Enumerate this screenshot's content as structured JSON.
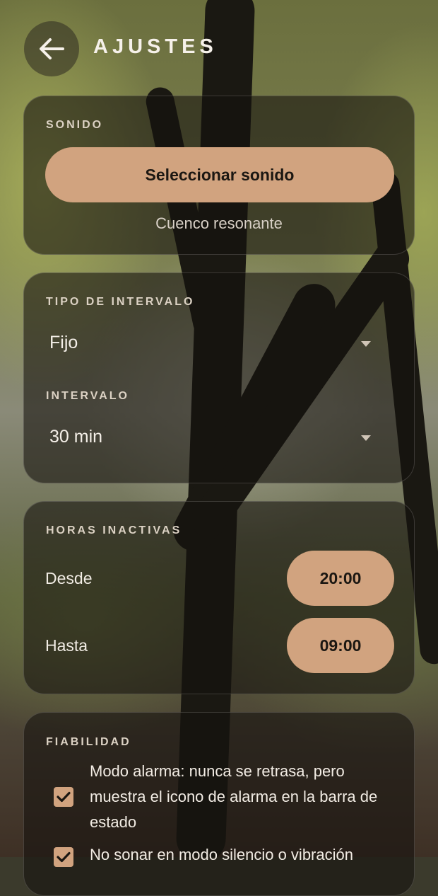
{
  "header": {
    "title": "AJUSTES",
    "back_icon": "arrow-left-icon"
  },
  "sound": {
    "section_label": "SONIDO",
    "select_button": "Seleccionar sonido",
    "current_sound": "Cuenco resonante"
  },
  "interval": {
    "type_label": "TIPO DE INTERVALO",
    "type_value": "Fijo",
    "interval_label": "INTERVALO",
    "interval_value": "30 min"
  },
  "inactive_hours": {
    "section_label": "HORAS INACTIVAS",
    "from_label": "Desde",
    "from_value": "20:00",
    "to_label": "Hasta",
    "to_value": "09:00"
  },
  "reliability": {
    "section_label": "FIABILIDAD",
    "options": [
      {
        "text": "Modo alarma: nunca se retrasa, pero muestra el icono de alarma en la barra de estado",
        "checked": true
      },
      {
        "text": "No sonar en modo silencio o vibración",
        "checked": true
      }
    ]
  },
  "colors": {
    "accent": "#d1a37f",
    "card_bg": "#141210"
  }
}
